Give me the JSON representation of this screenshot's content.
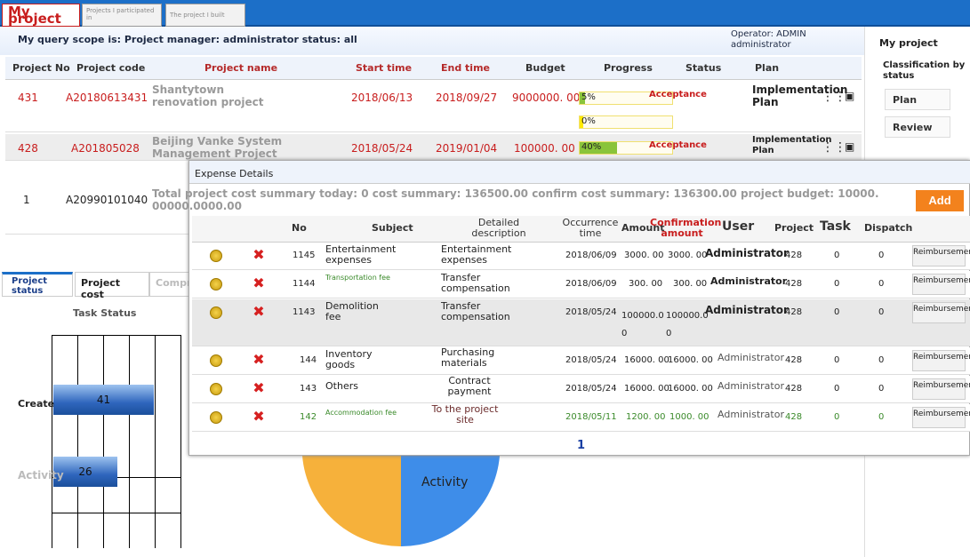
{
  "tabs": {
    "my_project": "My project",
    "participated": "Projects I participated in",
    "built": "The project I built"
  },
  "scope": {
    "text": "My query scope is: Project manager: administrator status: all",
    "operator": "Operator: ADMIN administrator"
  },
  "project_table": {
    "headers": [
      "Project No",
      "Project code",
      "Project name",
      "Start time",
      "End time",
      "Budget",
      "Progress",
      "Status",
      "Plan"
    ],
    "rows": [
      {
        "no": "431",
        "code": "A20180613431",
        "name": "Shantytown renovation project",
        "start": "2018/06/13",
        "end": "2018/09/27",
        "budget": "9000000. 00",
        "progress1": "5%",
        "progress2": "0%",
        "status": "Acceptance",
        "plan": "Implementation Plan"
      },
      {
        "no": "428",
        "code": "A201805028",
        "name": "Beijing Vanke System Management Project",
        "start": "2018/05/24",
        "end": "2019/01/04",
        "budget": "100000. 00",
        "progress1": "40%",
        "status": "Acceptance",
        "plan": "Implementation Plan"
      },
      {
        "no": "1",
        "code": "A20990101040"
      }
    ]
  },
  "right_panel": {
    "title": "My project",
    "classification": "Classification by status",
    "plan": "Plan",
    "review": "Review"
  },
  "lower_tabs": {
    "status": "Project status",
    "cost": "Project cost",
    "comprehensive": "Comprehensive"
  },
  "task_chart_title": "Task Status",
  "chart_data": {
    "type": "bar",
    "title": "Task Status",
    "categories": [
      "Create",
      "Activity"
    ],
    "values": [
      41,
      26
    ]
  },
  "pie_label": "Activity",
  "colors": {
    "accent": "#c81d1d",
    "brand": "#1c6fc8",
    "add": "#f3821d"
  },
  "modal": {
    "title": "Expense Details",
    "summary": "Total project cost summary today: 0 cost summary: 136500.00 confirm cost summary: 136300.00 project budget: 10000. 00000.0000.00",
    "add": "Add",
    "headers": {
      "no": "No",
      "subject": "Subject",
      "desc": "Detailed description",
      "time": "Occurrence time",
      "amount": "Amount",
      "confirm": "Confirmation amount",
      "user": "User",
      "project": "Project",
      "task": "Task",
      "dispatch": "Dispatch"
    },
    "rows": [
      {
        "no": "1145",
        "subject": "Entertainment expenses",
        "desc": "Entertainment expenses",
        "time": "2018/06/09",
        "amount": "3000. 00",
        "confirm": "3000. 00",
        "user": "Administrator",
        "project": "428",
        "task": "0",
        "dispatch": "0",
        "action": "Reimbursement"
      },
      {
        "no": "1144",
        "subject": "Transportation fee",
        "desc": "Transfer compensation",
        "time": "2018/06/09",
        "amount": "300. 00",
        "confirm": "300. 00",
        "user": "Administrator",
        "project": "428",
        "task": "0",
        "dispatch": "0",
        "action": "Reimbursement"
      },
      {
        "no": "1143",
        "subject": "Demolition fee",
        "desc": "Transfer compensation",
        "time": "2018/05/24",
        "amount": "100000.0 0",
        "confirm": "100000.0 0",
        "user": "Administrator",
        "project": "428",
        "task": "0",
        "dispatch": "0",
        "action": "Reimbursement"
      },
      {
        "no": "144",
        "subject": "Inventory goods",
        "desc": "Purchasing materials",
        "time": "2018/05/24",
        "amount": "16000. 00",
        "confirm": "16000. 00",
        "user": "Administrator",
        "project": "428",
        "task": "0",
        "dispatch": "0",
        "action": "Reimbursement"
      },
      {
        "no": "143",
        "subject": "Others",
        "desc": "Contract payment",
        "time": "2018/05/24",
        "amount": "16000. 00",
        "confirm": "16000. 00",
        "user": "Administrator",
        "project": "428",
        "task": "0",
        "dispatch": "0",
        "action": "Reimbursement"
      },
      {
        "no": "142",
        "subject": "Accommodation fee",
        "desc": "To the project site",
        "time": "2018/05/11",
        "amount": "1200. 00",
        "confirm": "1000. 00",
        "user": "Administrator",
        "project": "428",
        "task": "0",
        "dispatch": "0",
        "action": "Reimbursement"
      }
    ],
    "page": "1"
  }
}
